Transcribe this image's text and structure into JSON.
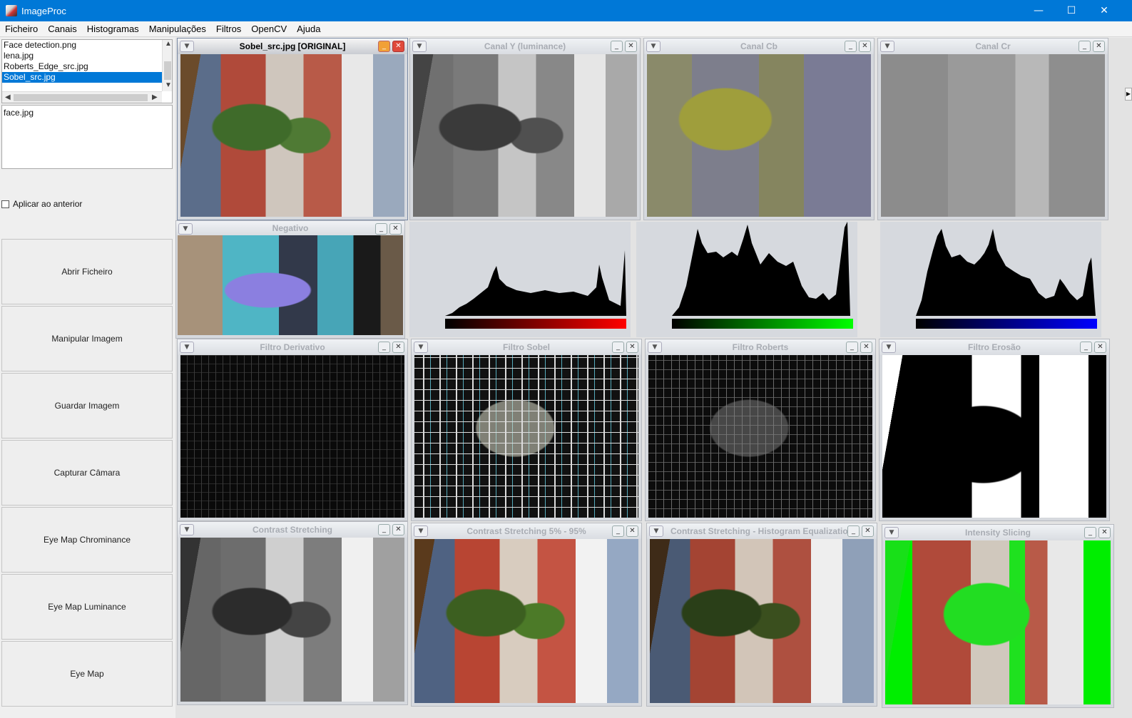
{
  "window": {
    "title": "ImageProc",
    "minimize": "—",
    "maximize": "☐",
    "close": "✕"
  },
  "menu": [
    "Ficheiro",
    "Canais",
    "Histogramas",
    "Manipulações",
    "Filtros",
    "OpenCV",
    "Ajuda"
  ],
  "file_list": [
    "Face detection.png",
    "lena.jpg",
    "Roberts_Edge_src.jpg",
    "Sobel_src.jpg"
  ],
  "selected_file": "Sobel_src.jpg",
  "secondary_list": [
    "face.jpg"
  ],
  "apply_previous_label": "Aplicar ao anterior",
  "buttons": {
    "open": "Abrir Ficheiro",
    "manipulate": "Manipular Imagem",
    "save": "Guardar Imagem",
    "camera": "Capturar Câmara",
    "eye_chroma": "Eye Map Chrominance",
    "eye_lum": "Eye Map Luminance",
    "eye_map": "Eye Map"
  },
  "frames": {
    "original": "Sobel_src.jpg [ORIGINAL]",
    "canal_y": "Canal Y (luminance)",
    "canal_cb": "Canal Cb",
    "canal_cr": "Canal Cr",
    "negativo": "Negativo",
    "filtro_derivativo": "Filtro Derivativo",
    "filtro_sobel": "Filtro Sobel",
    "filtro_roberts": "Filtro Roberts",
    "filtro_erosao": "Filtro Erosão",
    "contrast_stretching": "Contrast Stretching",
    "contrast_5_95": "Contrast Stretching 5% - 95%",
    "contrast_histeq": "Contrast Stretching - Histogram Equalization",
    "intensity_slicing": "Intensity Slicing"
  },
  "histograms": {
    "red": {
      "color_from": "#000000",
      "color_to": "#ff0000"
    },
    "green": {
      "color_from": "#000000",
      "color_to": "#00ff00"
    },
    "blue": {
      "color_from": "#000000",
      "color_to": "#0000ff"
    }
  },
  "frame_buttons": {
    "menu": "▼",
    "minimize": "_",
    "close": "✕"
  }
}
